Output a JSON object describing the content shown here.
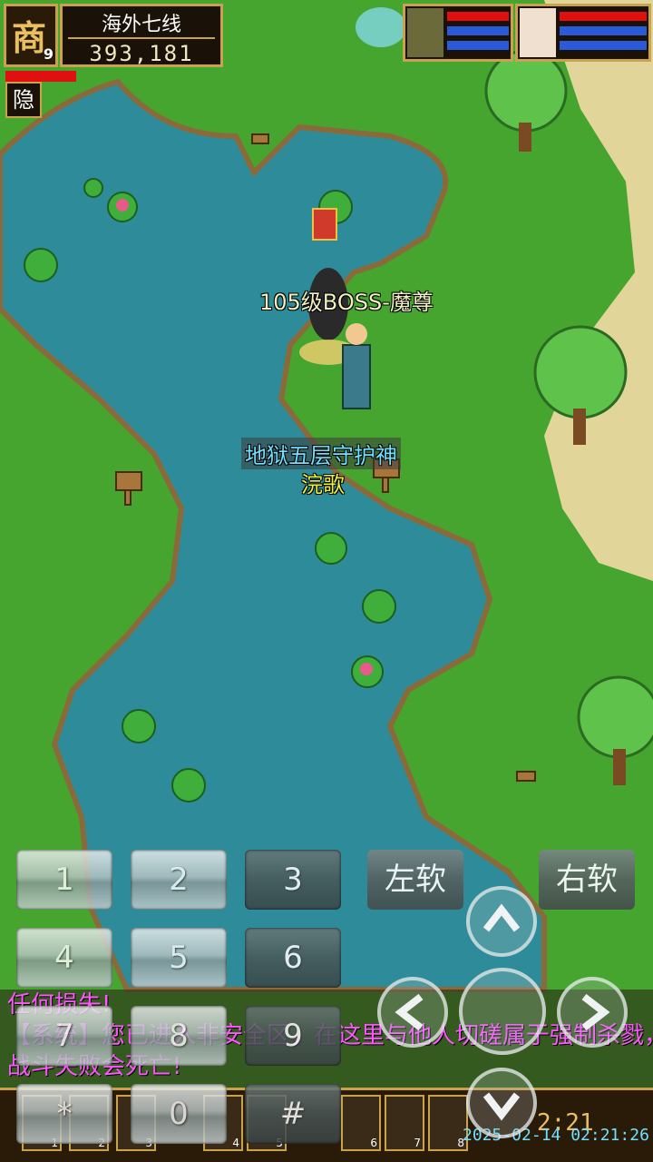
{
  "hud": {
    "badge_glyph": "商",
    "badge_level": "9",
    "server_name": "海外七线",
    "gold": "393,181",
    "hide_label": "隐"
  },
  "world": {
    "boss_name": "105级BOSS-魔尊",
    "npc_title": "地狱五层守护神",
    "npc_name": "浣歌"
  },
  "keypad": {
    "keys": [
      "1",
      "2",
      "3",
      "4",
      "5",
      "6",
      "7",
      "8",
      "9",
      "*",
      "0",
      "#"
    ],
    "left_soft": "左软",
    "right_soft": "右软"
  },
  "chat": {
    "lines": [
      "任何损失!",
      "【系统】您已进入非安全区，在这里与他人切磋属于强制杀戮，",
      "战斗失败会死亡!"
    ]
  },
  "skillbar": {
    "slot_numbers": [
      "1",
      "2",
      "3",
      "4",
      "5",
      "6",
      "7",
      "8"
    ],
    "clock": "2:21",
    "timestamp": "2025-02-14 02:21:26"
  },
  "colors": {
    "gold_border": "#c9a24a",
    "hp": "#e01010",
    "mp": "#2a5ad8",
    "chat_text": "#ff55ff",
    "timestamp": "#6fe0ff"
  }
}
